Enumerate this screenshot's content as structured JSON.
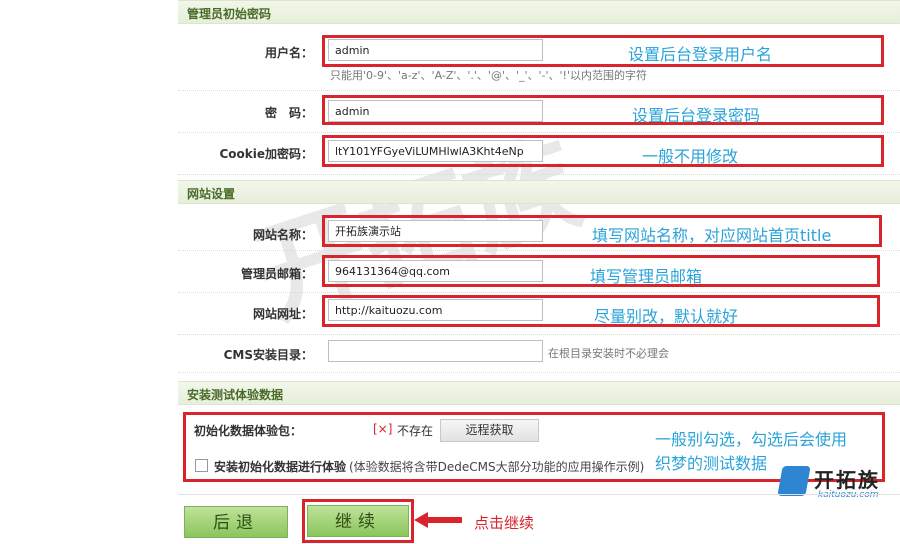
{
  "sections": {
    "admin_title": "管理员初始密码",
    "site_title": "网站设置",
    "test_title": "安装测试体验数据"
  },
  "fields": {
    "username": {
      "label": "用户名：",
      "value": "admin",
      "hint": "只能用'0-9'、'a-z'、'A-Z'、'.'、'@'、'_'、'-'、'!'以内范围的字符",
      "note": "设置后台登录用户名"
    },
    "password": {
      "label": "密　码：",
      "value": "admin",
      "note": "设置后台登录密码"
    },
    "cookie": {
      "label": "Cookie加密码：",
      "value": "ltY101YFGyeViLUMHlwlA3Kht4eNp",
      "note": "一般不用修改"
    },
    "sitename": {
      "label": "网站名称：",
      "value": "开拓族演示站",
      "note": "填写网站名称，对应网站首页title"
    },
    "email": {
      "label": "管理员邮箱：",
      "value": "964131364@qq.com",
      "note": "填写管理员邮箱"
    },
    "siteurl": {
      "label": "网站网址：",
      "value": "http://kaituozu.com",
      "note": "尽量别改，默认就好"
    },
    "cmsdir": {
      "label": "CMS安装目录：",
      "value": "",
      "hint": "在根目录安装时不必理会"
    }
  },
  "testdata": {
    "package_label": "初始化数据体验包：",
    "status_mark": "[×]",
    "status_text": "不存在",
    "fetch_button": "远程获取",
    "checkbox_label_bold": "安装初始化数据进行体验",
    "checkbox_label_rest": "(体验数据将含带DedeCMS大部分功能的应用操作示例)",
    "checkbox_checked": false,
    "note_line1": "一般别勾选，勾选后会使用",
    "note_line2": "织梦的测试数据"
  },
  "buttons": {
    "back": "后退",
    "continue": "继续"
  },
  "annotation": "点击继续",
  "logo": {
    "text": "开拓族",
    "domain": "kaituozu.com"
  },
  "colors": {
    "accent_red": "#d9242c",
    "note_blue": "#2aa3d8",
    "button_green": "#8bc55c"
  }
}
